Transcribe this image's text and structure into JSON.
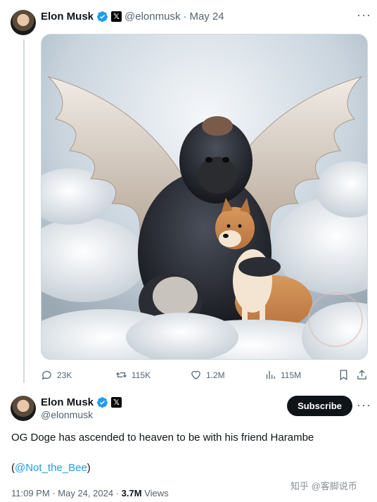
{
  "tweet1": {
    "author": "Elon Musk",
    "handle": "@elonmusk",
    "separator": "·",
    "date": "May 24",
    "stats": {
      "replies": "23K",
      "retweets": "115K",
      "likes": "1.2M",
      "views": "115M"
    }
  },
  "tweet2": {
    "author": "Elon Musk",
    "handle": "@elonmusk",
    "subscribe_label": "Subscribe",
    "text": "OG Doge has ascended to heaven to be with his friend Harambe",
    "mention_open": "(",
    "mention": "@Not_the_Bee",
    "mention_close": ")",
    "time": "11:09 PM",
    "sep1": "·",
    "date": "May 24, 2024",
    "sep2": "·",
    "views_count": "3.7M",
    "views_label": "Views"
  },
  "watermark": "知乎 @客脚说币",
  "colors": {
    "accent": "#1d9bf0",
    "text": "#0f1419",
    "muted": "#536471"
  }
}
